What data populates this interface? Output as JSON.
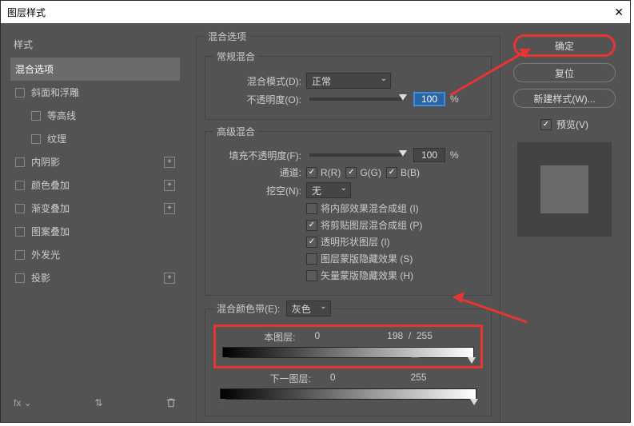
{
  "title": "图层样式",
  "sidebar": {
    "header": "样式",
    "items": [
      {
        "label": "混合选项",
        "selected": true,
        "hasPlus": false,
        "sub": false,
        "checkbox": false
      },
      {
        "label": "斜面和浮雕",
        "hasPlus": false,
        "sub": false,
        "checkbox": true
      },
      {
        "label": "等高线",
        "hasPlus": false,
        "sub": true,
        "checkbox": true
      },
      {
        "label": "纹理",
        "hasPlus": false,
        "sub": true,
        "checkbox": true
      },
      {
        "label": "内阴影",
        "hasPlus": true,
        "sub": false,
        "checkbox": true
      },
      {
        "label": "颜色叠加",
        "hasPlus": true,
        "sub": false,
        "checkbox": true
      },
      {
        "label": "渐变叠加",
        "hasPlus": true,
        "sub": false,
        "checkbox": true
      },
      {
        "label": "图案叠加",
        "hasPlus": false,
        "sub": false,
        "checkbox": true
      },
      {
        "label": "外发光",
        "hasPlus": false,
        "sub": false,
        "checkbox": true
      },
      {
        "label": "投影",
        "hasPlus": true,
        "sub": false,
        "checkbox": true
      }
    ],
    "footer_fx": "fx"
  },
  "main": {
    "title": "混合选项",
    "general": {
      "title": "常规混合",
      "mode_label": "混合模式(D):",
      "mode_value": "正常",
      "opacity_label": "不透明度(O):",
      "opacity_value": "100",
      "pct": "%"
    },
    "advanced": {
      "title": "高级混合",
      "fill_label": "填充不透明度(F):",
      "fill_value": "100",
      "channels_label": "通道:",
      "ch_r": "R(R)",
      "ch_g": "G(G)",
      "ch_b": "B(B)",
      "knockout_label": "挖空(N):",
      "knockout_value": "无",
      "opt1": "将内部效果混合成组 (I)",
      "opt2": "将剪贴图层混合成组 (P)",
      "opt3": "透明形状图层 (I)",
      "opt4": "图层蒙版隐藏效果 (S)",
      "opt5": "矢量蒙版隐藏效果 (H)"
    },
    "blendif": {
      "title": "混合颜色带(E):",
      "channel": "灰色",
      "this_label": "本图层:",
      "this_black": "0",
      "this_white_a": "198",
      "this_slash": "/",
      "this_white_b": "255",
      "under_label": "下一图层:",
      "under_black": "0",
      "under_white": "255"
    }
  },
  "right": {
    "ok": "确定",
    "reset": "复位",
    "newstyle": "新建样式(W)...",
    "preview_label": "预览(V)"
  }
}
